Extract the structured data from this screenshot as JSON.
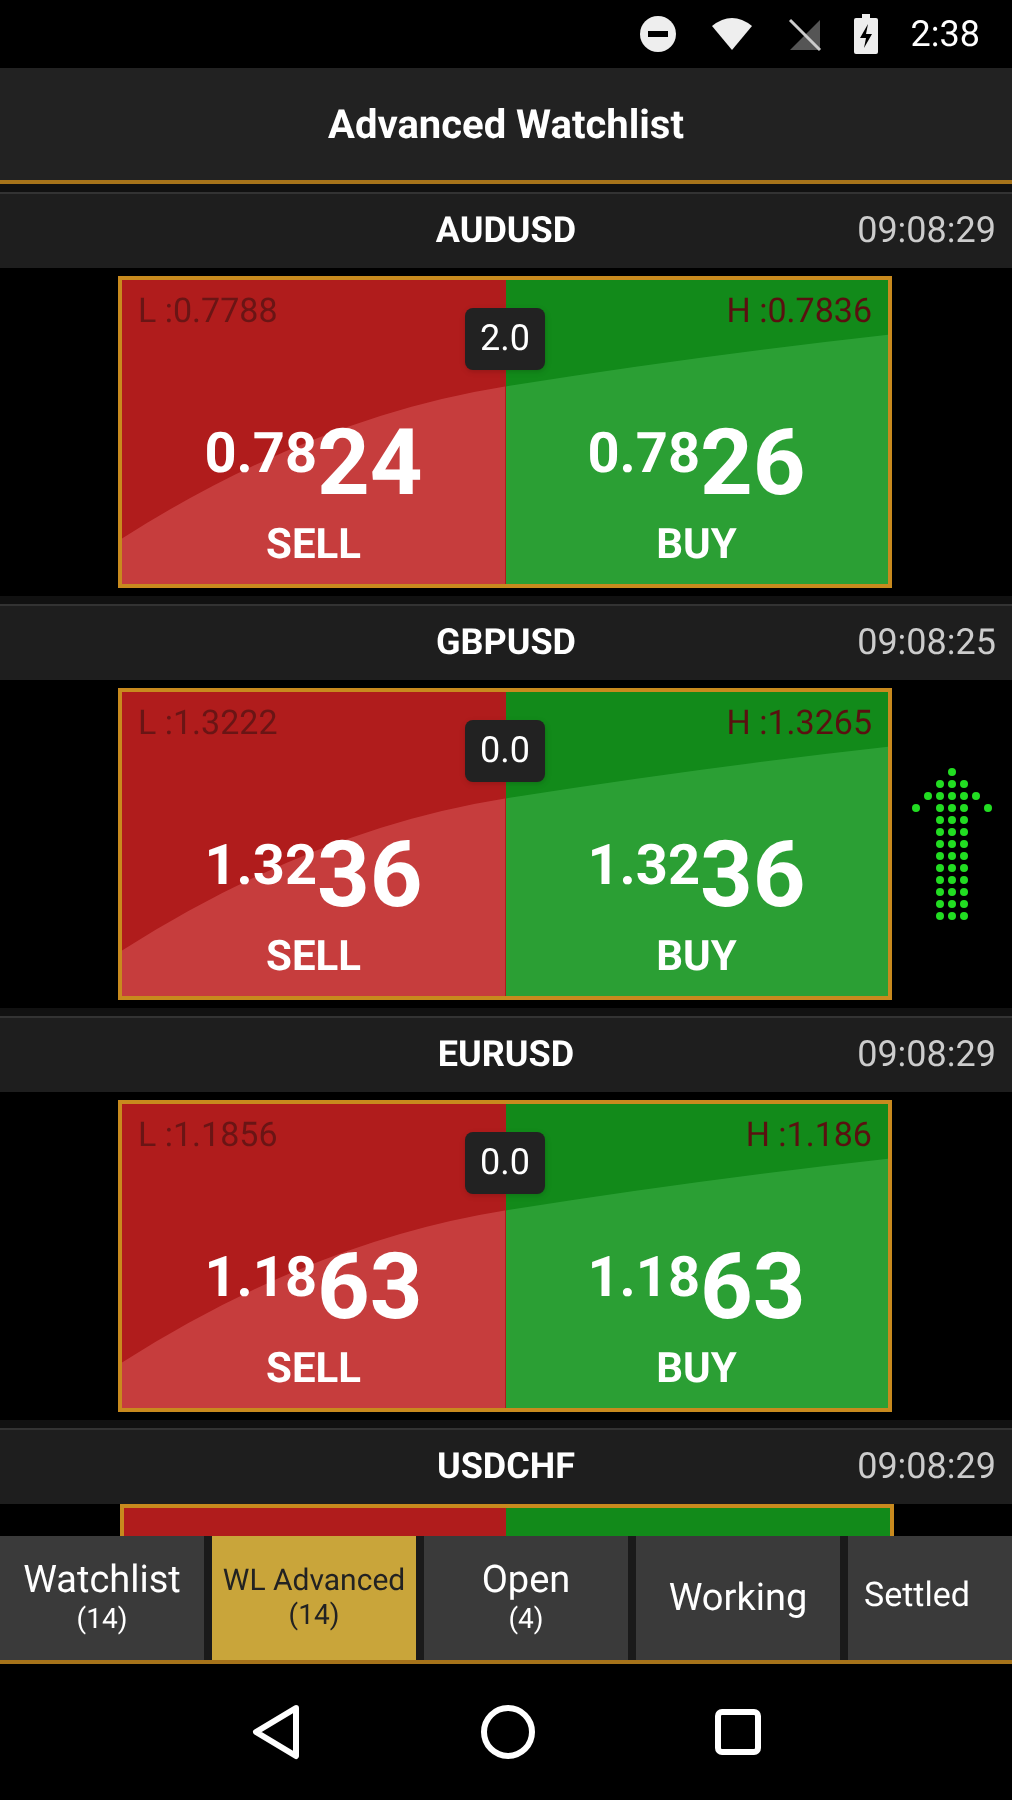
{
  "status_bar": {
    "time": "2:38"
  },
  "title": "Advanced Watchlist",
  "rows": [
    {
      "symbol": "AUDUSD",
      "time": "09:08:29",
      "low": "L :0.7788",
      "high": "H :0.7836",
      "spread": "2.0",
      "sell_prefix": "0.78",
      "sell_big": "24",
      "sell_label": "SELL",
      "buy_prefix": "0.78",
      "buy_big": "26",
      "buy_label": "BUY",
      "rising": false
    },
    {
      "symbol": "GBPUSD",
      "time": "09:08:25",
      "low": "L :1.3222",
      "high": "H :1.3265",
      "spread": "0.0",
      "sell_prefix": "1.32",
      "sell_big": "36",
      "sell_label": "SELL",
      "buy_prefix": "1.32",
      "buy_big": "36",
      "buy_label": "BUY",
      "rising": true
    },
    {
      "symbol": "EURUSD",
      "time": "09:08:29",
      "low": "L :1.1856",
      "high": "H :1.186",
      "spread": "0.0",
      "sell_prefix": "1.18",
      "sell_big": "63",
      "sell_label": "SELL",
      "buy_prefix": "1.18",
      "buy_big": "63",
      "buy_label": "BUY",
      "rising": false
    },
    {
      "symbol": "USDCHF",
      "time": "09:08:29"
    }
  ],
  "tabs": [
    {
      "label": "Watchlist",
      "count": "(14)",
      "selected": false
    },
    {
      "label": "WL Advanced",
      "count": "(14)",
      "selected": true
    },
    {
      "label": "Open",
      "count": "(4)",
      "selected": false
    },
    {
      "label": "Working",
      "selected": false
    },
    {
      "label": "Settled",
      "selected": false
    }
  ]
}
